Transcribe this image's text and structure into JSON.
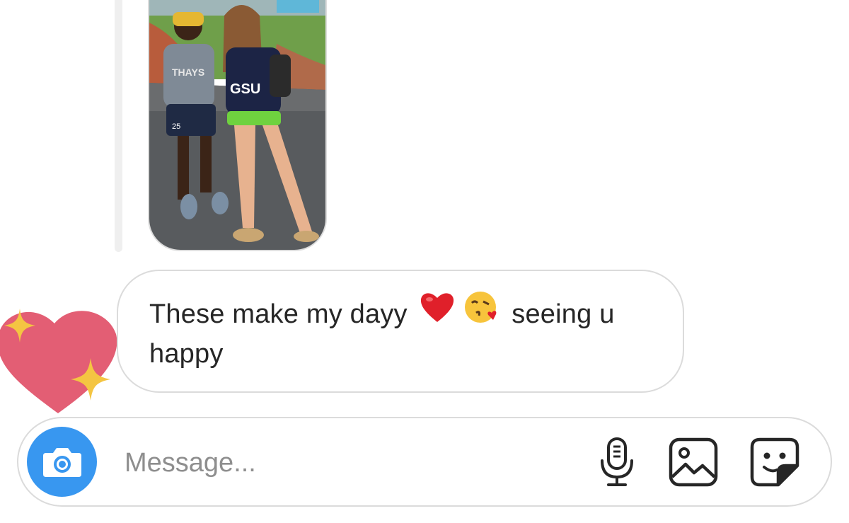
{
  "thread": {
    "shared_photo": {
      "alt": "Two young women standing on pavement laughing",
      "shirt_text": "GSU",
      "shorts_number": "25"
    },
    "reaction": {
      "icon": "sparkling-heart-icon"
    },
    "message": {
      "text_before": "These make my dayy",
      "emoji_1": "red-heart-emoji",
      "emoji_2": "kissing-face-emoji",
      "text_after": "seeing u happy"
    }
  },
  "composer": {
    "placeholder": "Message...",
    "camera_icon": "camera-icon",
    "mic_icon": "microphone-icon",
    "gallery_icon": "image-gallery-icon",
    "sticker_icon": "sticker-icon",
    "accent_color": "#3897f0"
  }
}
